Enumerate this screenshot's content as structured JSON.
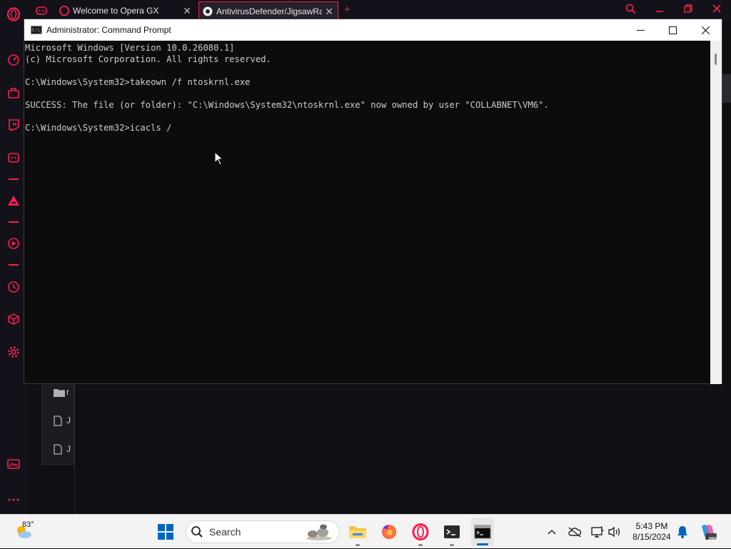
{
  "browser": {
    "tabs": [
      {
        "title": "Welcome to Opera GX",
        "active": false
      },
      {
        "title": "AntivirusDefender/JigsawRansomware",
        "active": true
      }
    ]
  },
  "background_list": [
    "r",
    "J",
    "J"
  ],
  "cmd": {
    "title": "Administrator: Command Prompt",
    "icon_text": "C:\\_",
    "lines": [
      "Microsoft Windows [Version 10.0.26080.1]",
      "(c) Microsoft Corporation. All rights reserved.",
      "",
      "C:\\Windows\\System32>takeown /f ntoskrnl.exe",
      "",
      "SUCCESS: The file (or folder): \"C:\\Windows\\System32\\ntoskrnl.exe\" now owned by user \"COLLABNET\\VM6\".",
      "",
      "C:\\Windows\\System32>icacls /"
    ]
  },
  "taskbar": {
    "weather_temp": "83°",
    "search_label": "Search",
    "time": "5:43 PM",
    "date": "8/15/2024",
    "copilot_badge": "PRE"
  },
  "colors": {
    "opera_accent": "#fa1e4e",
    "console_bg": "#0c0c0c",
    "console_text": "#cccccc",
    "taskbar_bg": "#f3f3f3",
    "windows_blue": "#0067c0"
  }
}
